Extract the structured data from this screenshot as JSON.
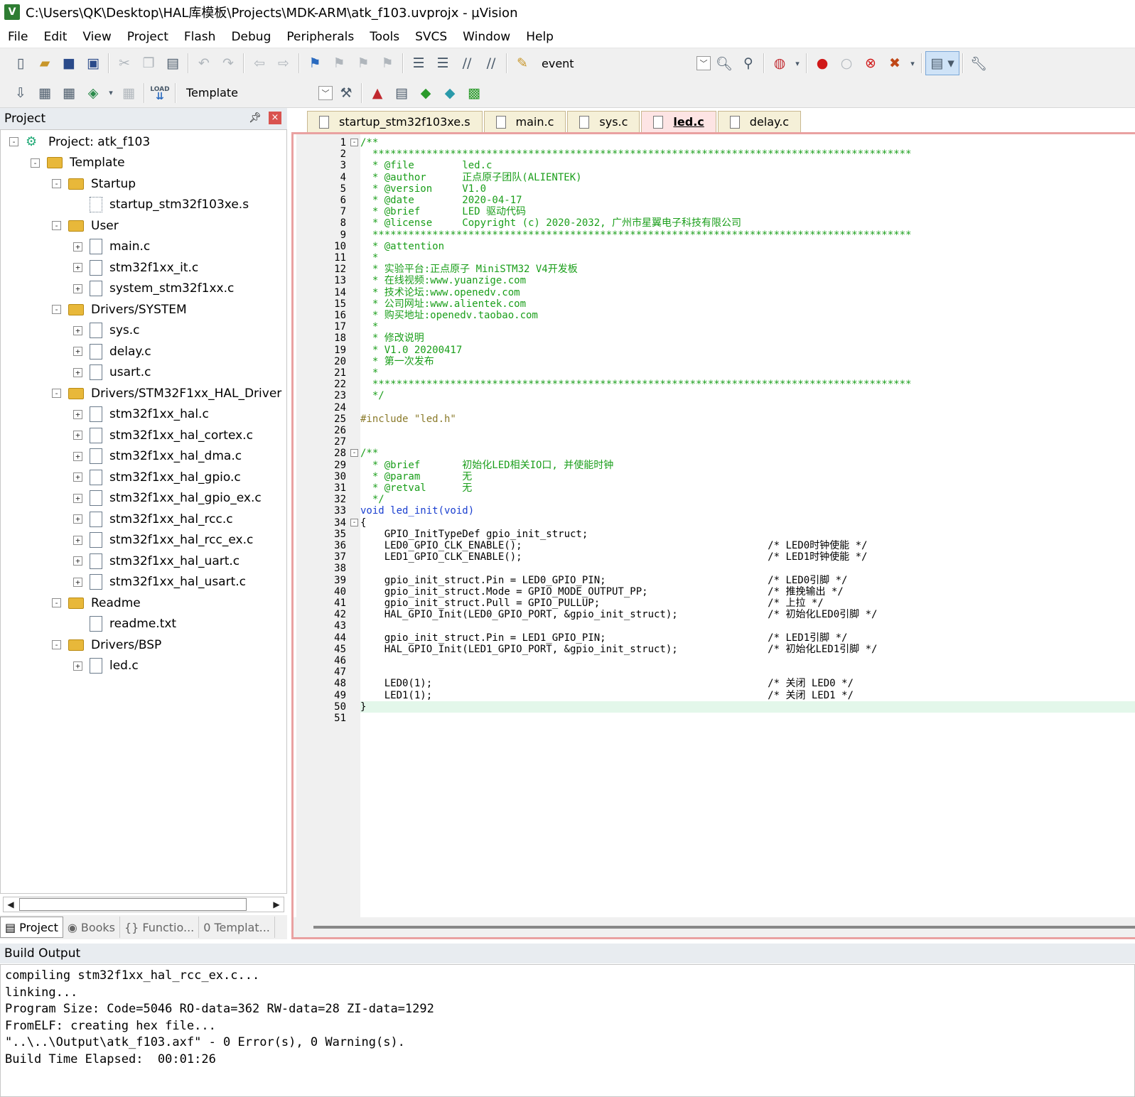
{
  "window": {
    "title": "C:\\Users\\QK\\Desktop\\HAL库模板\\Projects\\MDK-ARM\\atk_f103.uvprojx - µVision",
    "logo": "V"
  },
  "menu": [
    "File",
    "Edit",
    "View",
    "Project",
    "Flash",
    "Debug",
    "Peripherals",
    "Tools",
    "SVCS",
    "Window",
    "Help"
  ],
  "toolbar": {
    "find_combo": "event",
    "target_combo": "Template",
    "load_label": "LOAD"
  },
  "project_panel": {
    "title": "Project",
    "tree": [
      {
        "label": "Project: atk_f103",
        "type": "project",
        "level": 0,
        "toggle": "-"
      },
      {
        "label": "Template",
        "type": "target",
        "level": 1,
        "toggle": "-"
      },
      {
        "label": "Startup",
        "type": "folder",
        "level": 2,
        "toggle": "-"
      },
      {
        "label": "startup_stm32f103xe.s",
        "type": "asm",
        "level": 3,
        "toggle": ""
      },
      {
        "label": "User",
        "type": "folder",
        "level": 2,
        "toggle": "-"
      },
      {
        "label": "main.c",
        "type": "file",
        "level": 3,
        "toggle": "+"
      },
      {
        "label": "stm32f1xx_it.c",
        "type": "file",
        "level": 3,
        "toggle": "+"
      },
      {
        "label": "system_stm32f1xx.c",
        "type": "file",
        "level": 3,
        "toggle": "+"
      },
      {
        "label": "Drivers/SYSTEM",
        "type": "folder",
        "level": 2,
        "toggle": "-"
      },
      {
        "label": "sys.c",
        "type": "file",
        "level": 3,
        "toggle": "+"
      },
      {
        "label": "delay.c",
        "type": "file",
        "level": 3,
        "toggle": "+"
      },
      {
        "label": "usart.c",
        "type": "file",
        "level": 3,
        "toggle": "+"
      },
      {
        "label": "Drivers/STM32F1xx_HAL_Driver",
        "type": "folder",
        "level": 2,
        "toggle": "-"
      },
      {
        "label": "stm32f1xx_hal.c",
        "type": "file",
        "level": 3,
        "toggle": "+"
      },
      {
        "label": "stm32f1xx_hal_cortex.c",
        "type": "file",
        "level": 3,
        "toggle": "+"
      },
      {
        "label": "stm32f1xx_hal_dma.c",
        "type": "file",
        "level": 3,
        "toggle": "+"
      },
      {
        "label": "stm32f1xx_hal_gpio.c",
        "type": "file",
        "level": 3,
        "toggle": "+"
      },
      {
        "label": "stm32f1xx_hal_gpio_ex.c",
        "type": "file",
        "level": 3,
        "toggle": "+"
      },
      {
        "label": "stm32f1xx_hal_rcc.c",
        "type": "file",
        "level": 3,
        "toggle": "+"
      },
      {
        "label": "stm32f1xx_hal_rcc_ex.c",
        "type": "file",
        "level": 3,
        "toggle": "+"
      },
      {
        "label": "stm32f1xx_hal_uart.c",
        "type": "file",
        "level": 3,
        "toggle": "+"
      },
      {
        "label": "stm32f1xx_hal_usart.c",
        "type": "file",
        "level": 3,
        "toggle": "+"
      },
      {
        "label": "Readme",
        "type": "folder",
        "level": 2,
        "toggle": "-"
      },
      {
        "label": "readme.txt",
        "type": "file",
        "level": 3,
        "toggle": ""
      },
      {
        "label": "Drivers/BSP",
        "type": "folder",
        "level": 2,
        "toggle": "-"
      },
      {
        "label": "led.c",
        "type": "file",
        "level": 3,
        "toggle": "+"
      }
    ],
    "tabs": [
      {
        "label": "Project",
        "icon": "project-tab-icon",
        "glyph": "▤"
      },
      {
        "label": "Books",
        "icon": "books-icon",
        "glyph": "◉"
      },
      {
        "label": "Functio...",
        "icon": "functions-icon",
        "glyph": "{}"
      },
      {
        "label": "Templat...",
        "icon": "templates-icon",
        "glyph": "0"
      }
    ]
  },
  "editor": {
    "tabs": [
      "startup_stm32f103xe.s",
      "main.c",
      "sys.c",
      "led.c",
      "delay.c"
    ],
    "active_tab": "led.c",
    "lines": [
      {
        "n": "1",
        "text": "/**",
        "cls": "c-cmt",
        "fold": "-"
      },
      {
        "n": "2",
        "text": "  ******************************************************************************************",
        "cls": "c-cmt"
      },
      {
        "n": "3",
        "text": "  * @file        led.c",
        "cls": "c-cmt"
      },
      {
        "n": "4",
        "text": "  * @author      正点原子团队(ALIENTEK)",
        "cls": "c-cmt"
      },
      {
        "n": "5",
        "text": "  * @version     V1.0",
        "cls": "c-cmt"
      },
      {
        "n": "6",
        "text": "  * @date        2020-04-17",
        "cls": "c-cmt"
      },
      {
        "n": "7",
        "text": "  * @brief       LED 驱动代码",
        "cls": "c-cmt"
      },
      {
        "n": "8",
        "text": "  * @license     Copyright (c) 2020-2032, 广州市星翼电子科技有限公司",
        "cls": "c-cmt"
      },
      {
        "n": "9",
        "text": "  ******************************************************************************************",
        "cls": "c-cmt"
      },
      {
        "n": "10",
        "text": "  * @attention",
        "cls": "c-cmt"
      },
      {
        "n": "11",
        "text": "  *",
        "cls": "c-cmt"
      },
      {
        "n": "12",
        "text": "  * 实验平台:正点原子 MiniSTM32 V4开发板",
        "cls": "c-cmt"
      },
      {
        "n": "13",
        "text": "  * 在线视频:www.yuanzige.com",
        "cls": "c-cmt"
      },
      {
        "n": "14",
        "text": "  * 技术论坛:www.openedv.com",
        "cls": "c-cmt"
      },
      {
        "n": "15",
        "text": "  * 公司网址:www.alientek.com",
        "cls": "c-cmt"
      },
      {
        "n": "16",
        "text": "  * 购买地址:openedv.taobao.com",
        "cls": "c-cmt"
      },
      {
        "n": "17",
        "text": "  *",
        "cls": "c-cmt"
      },
      {
        "n": "18",
        "text": "  * 修改说明",
        "cls": "c-cmt"
      },
      {
        "n": "19",
        "text": "  * V1.0 20200417",
        "cls": "c-cmt"
      },
      {
        "n": "20",
        "text": "  * 第一次发布",
        "cls": "c-cmt"
      },
      {
        "n": "21",
        "text": "  *",
        "cls": "c-cmt"
      },
      {
        "n": "22",
        "text": "  ******************************************************************************************",
        "cls": "c-cmt"
      },
      {
        "n": "23",
        "text": "  */",
        "cls": "c-cmt"
      },
      {
        "n": "24",
        "text": "",
        "cls": ""
      },
      {
        "n": "25",
        "text": "#include \"led.h\"",
        "cls": "c-pp"
      },
      {
        "n": "26",
        "text": "",
        "cls": ""
      },
      {
        "n": "27",
        "text": "",
        "cls": ""
      },
      {
        "n": "28",
        "text": "/**",
        "cls": "c-cmt",
        "fold": "-"
      },
      {
        "n": "29",
        "text": "  * @brief       初始化LED相关IO口, 并使能时钟",
        "cls": "c-cmt"
      },
      {
        "n": "30",
        "text": "  * @param       无",
        "cls": "c-cmt"
      },
      {
        "n": "31",
        "text": "  * @retval      无",
        "cls": "c-cmt"
      },
      {
        "n": "32",
        "text": "  */",
        "cls": "c-cmt"
      },
      {
        "n": "33",
        "text": "void led_init(void)",
        "cls": "c-kw"
      },
      {
        "n": "34",
        "text": "{",
        "cls": "",
        "fold": "-"
      },
      {
        "n": "35",
        "text": "    GPIO_InitTypeDef gpio_init_struct;",
        "cls": ""
      },
      {
        "n": "36",
        "text": "    LED0_GPIO_CLK_ENABLE();                                         /* LED0时钟使能 */",
        "cls": ""
      },
      {
        "n": "37",
        "text": "    LED1_GPIO_CLK_ENABLE();                                         /* LED1时钟使能 */",
        "cls": ""
      },
      {
        "n": "38",
        "text": "",
        "cls": ""
      },
      {
        "n": "39",
        "text": "    gpio_init_struct.Pin = LED0_GPIO_PIN;                           /* LED0引脚 */",
        "cls": ""
      },
      {
        "n": "40",
        "text": "    gpio_init_struct.Mode = GPIO_MODE_OUTPUT_PP;                    /* 推挽输出 */",
        "cls": ""
      },
      {
        "n": "41",
        "text": "    gpio_init_struct.Pull = GPIO_PULLUP;                            /* 上拉 */",
        "cls": ""
      },
      {
        "n": "42",
        "text": "    HAL_GPIO_Init(LED0_GPIO_PORT, &gpio_init_struct);               /* 初始化LED0引脚 */",
        "cls": ""
      },
      {
        "n": "43",
        "text": "",
        "cls": ""
      },
      {
        "n": "44",
        "text": "    gpio_init_struct.Pin = LED1_GPIO_PIN;                           /* LED1引脚 */",
        "cls": ""
      },
      {
        "n": "45",
        "text": "    HAL_GPIO_Init(LED1_GPIO_PORT, &gpio_init_struct);               /* 初始化LED1引脚 */",
        "cls": ""
      },
      {
        "n": "46",
        "text": "",
        "cls": ""
      },
      {
        "n": "47",
        "text": "",
        "cls": ""
      },
      {
        "n": "48",
        "text": "    LED0(1);                                                        /* 关闭 LED0 */",
        "cls": ""
      },
      {
        "n": "49",
        "text": "    LED1(1);                                                        /* 关闭 LED1 */",
        "cls": ""
      },
      {
        "n": "50",
        "text": "}",
        "cls": "",
        "hl": true
      },
      {
        "n": "51",
        "text": "",
        "cls": ""
      }
    ]
  },
  "build_output": {
    "title": "Build Output",
    "lines": [
      "compiling stm32f1xx_hal_rcc_ex.c...",
      "linking...",
      "Program Size: Code=5046 RO-data=362 RW-data=28 ZI-data=1292",
      "FromELF: creating hex file...",
      "\"..\\..\\Output\\atk_f103.axf\" - 0 Error(s), 0 Warning(s).",
      "Build Time Elapsed:  00:01:26"
    ]
  },
  "colors": {
    "comment": "#1a9e1a",
    "keyword": "#1a3fd0",
    "editor_border": "#e9a1a1",
    "current_line": "#e3f7ea"
  }
}
